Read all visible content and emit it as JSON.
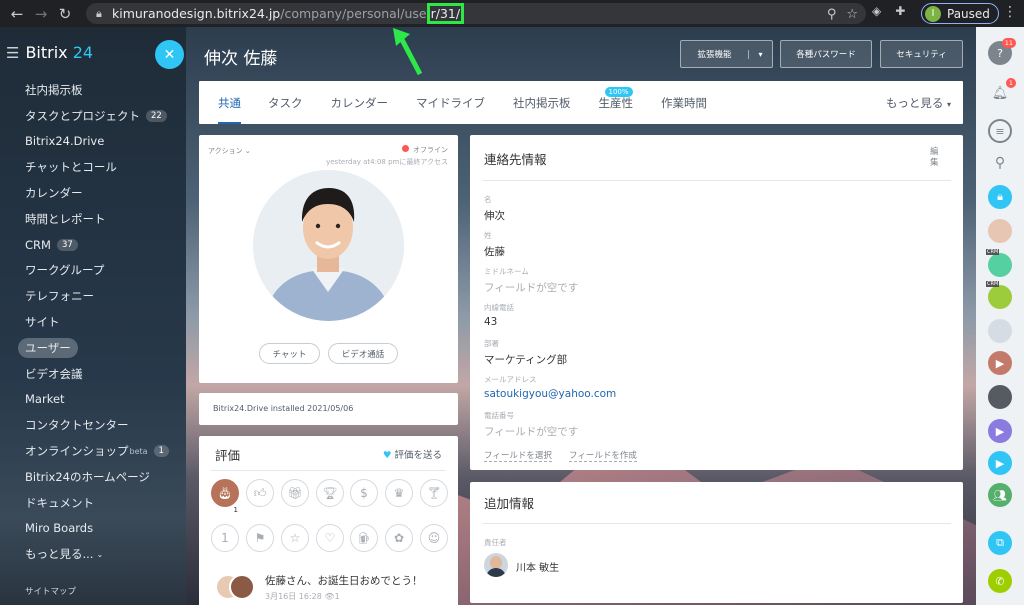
{
  "browser": {
    "url_host": "kimuranodesign.bitrix24.jp",
    "url_path": "/company/personal/use",
    "url_highlight": "r/31/",
    "profile_status": "Paused",
    "profile_initial": "I"
  },
  "sidebar": {
    "logo_brand": "Bitrix",
    "logo_num": "24",
    "items": [
      {
        "label": "社内掲示板",
        "count": ""
      },
      {
        "label": "タスクとプロジェクト",
        "count": "22"
      },
      {
        "label": "Bitrix24.Drive",
        "count": ""
      },
      {
        "label": "チャットとコール",
        "count": ""
      },
      {
        "label": "カレンダー",
        "count": ""
      },
      {
        "label": "時間とレポート",
        "count": ""
      },
      {
        "label": "CRM",
        "count": "37"
      },
      {
        "label": "ワークグループ",
        "count": ""
      },
      {
        "label": "テレフォニー",
        "count": ""
      },
      {
        "label": "サイト",
        "count": ""
      },
      {
        "label": "ユーザー",
        "count": ""
      },
      {
        "label": "ビデオ会議",
        "count": ""
      },
      {
        "label": "Market",
        "count": ""
      },
      {
        "label": "コンタクトセンター",
        "count": ""
      },
      {
        "label": "オンラインショップ",
        "count": "1",
        "beta": "beta"
      },
      {
        "label": "Bitrix24のホームページ",
        "count": ""
      },
      {
        "label": "ドキュメント",
        "count": ""
      },
      {
        "label": "Miro Boards",
        "count": ""
      },
      {
        "label": "もっと見る...",
        "count": ""
      }
    ],
    "sitemap": "サイトマップ"
  },
  "panel": {
    "title": "伸次 佐藤",
    "btn_extensions": "拡張機能",
    "btn_passwords": "各種パスワード",
    "btn_security": "セキュリティ",
    "tabs": [
      "共通",
      "タスク",
      "カレンダー",
      "マイドライブ",
      "社内掲示板",
      "生産性",
      "作業時間"
    ],
    "productivity_pct": "100%",
    "tab_more": "もっと見る"
  },
  "profile": {
    "actions": "アクション",
    "status": "オフライン",
    "last_seen": "yesterday at4:08 pmに最終アクセス",
    "btn_chat": "チャット",
    "btn_video": "ビデオ通話",
    "drive_note": "Bitrix24.Drive installed 2021/05/06"
  },
  "appraisal": {
    "title": "評価",
    "send": "評価を送る",
    "badge_count": "1",
    "post_text": "佐藤さん、お誕生日おめでとう！",
    "post_date": "3月16日 16:28",
    "post_views": "1"
  },
  "contact": {
    "title": "連絡先情報",
    "edit": "編集",
    "fields": [
      {
        "label": "名",
        "value": "伸次"
      },
      {
        "label": "姓",
        "value": "佐藤"
      },
      {
        "label": "ミドルネーム",
        "value": "フィールドが空です"
      },
      {
        "label": "内線電話",
        "value": "43"
      },
      {
        "label": "部署",
        "value": "マーケティング部"
      },
      {
        "label": "メールアドレス",
        "value": "satoukigyou@yahoo.com"
      },
      {
        "label": "電話番号",
        "value": "フィールドが空です"
      }
    ],
    "link_select": "フィールドを選択",
    "link_create": "フィールドを作成"
  },
  "extra": {
    "title": "追加情報",
    "manager_label": "責任者",
    "manager_name": "川本 敏生"
  },
  "rail": {
    "help_badge": "11",
    "bell_badge": "1",
    "crm": "CRM"
  },
  "colors": {
    "accent": "#2fc6f6",
    "link": "#2067b0",
    "arrow": "#2ee84a",
    "offline": "#ff5752"
  }
}
